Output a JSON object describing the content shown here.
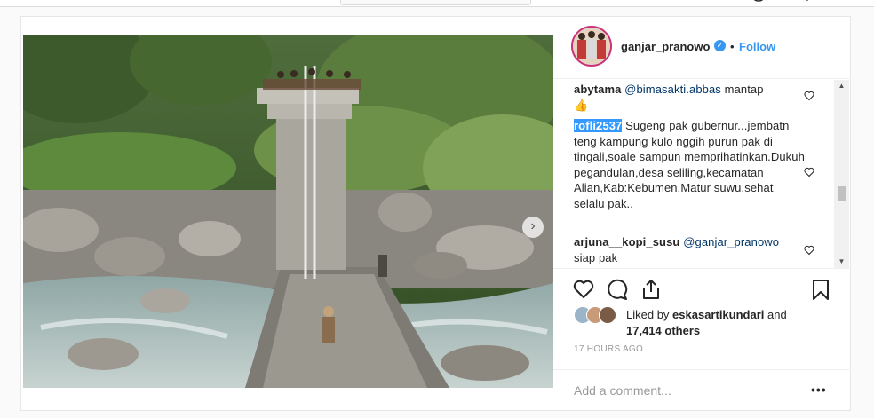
{
  "post": {
    "username": "ganjar_pranowo",
    "verified_badge": "✓",
    "separator": "•",
    "follow_label": "Follow",
    "next_arrow": "›"
  },
  "comments": [
    {
      "user": "abytama",
      "mention": "@bimasakti.abbas",
      "text": " mantap",
      "emoji": "👍"
    },
    {
      "user": "rofli2537",
      "text": " Sugeng pak gubernur...jembatn teng kampung kulo nggih purun pak di tingali,soale sampun memprihatinkan.Dukuh pegandulan,desa seliling,kecamatan Alian,Kab:Kebumen.Matur suwu,sehat selalu pak.."
    },
    {
      "user": "arjuna__kopi_susu",
      "mention": "@ganjar_pranowo",
      "text": " siap pak"
    }
  ],
  "likes": {
    "prefix": "Liked by ",
    "user": "eskasartikundari",
    "middle": " and",
    "count": "17,414 others"
  },
  "timestamp": "17 HOURS AGO",
  "add_comment_placeholder": "Add a comment...",
  "more_label": "•••",
  "icons": [
    "heart-icon",
    "comment-icon",
    "share-icon",
    "bookmark-icon",
    "verified-icon",
    "chevron-right-icon",
    "scroll-up-icon",
    "scroll-down-icon"
  ],
  "colors": {
    "link": "#3897f0",
    "text": "#262626",
    "muted": "#999999",
    "avatar_ring": "#c9327a"
  }
}
